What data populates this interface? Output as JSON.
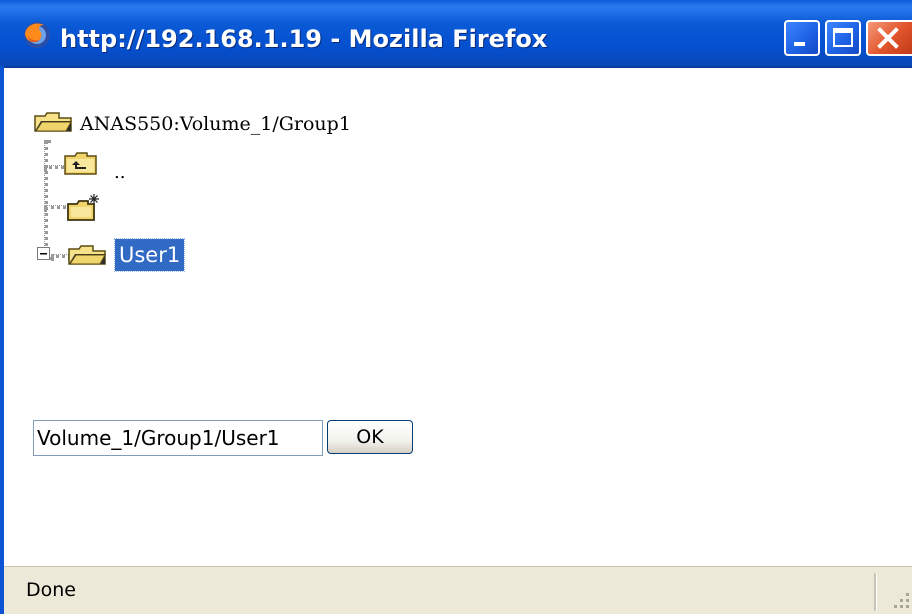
{
  "window": {
    "title": "http://192.168.1.19 - Mozilla Firefox",
    "buttons": [
      "minimize-icon",
      "maximize-icon",
      "close-icon"
    ]
  },
  "tree": {
    "root_label": "ANAS550:Volume_1/Group1",
    "items": [
      {
        "icon": "folder-up-icon",
        "label": ".."
      },
      {
        "icon": "new-folder-icon",
        "label": ""
      },
      {
        "icon": "folder-icon",
        "label": "User1",
        "expander": "collapse-minus-icon",
        "selected": true
      }
    ]
  },
  "form": {
    "path_value": "Volume_1/Group1/User1",
    "ok_label": "OK"
  },
  "status": {
    "text": "Done"
  },
  "colors": {
    "titlebar": "#0450cf",
    "selection": "#316ac5",
    "statusbar": "#ece9d8"
  }
}
